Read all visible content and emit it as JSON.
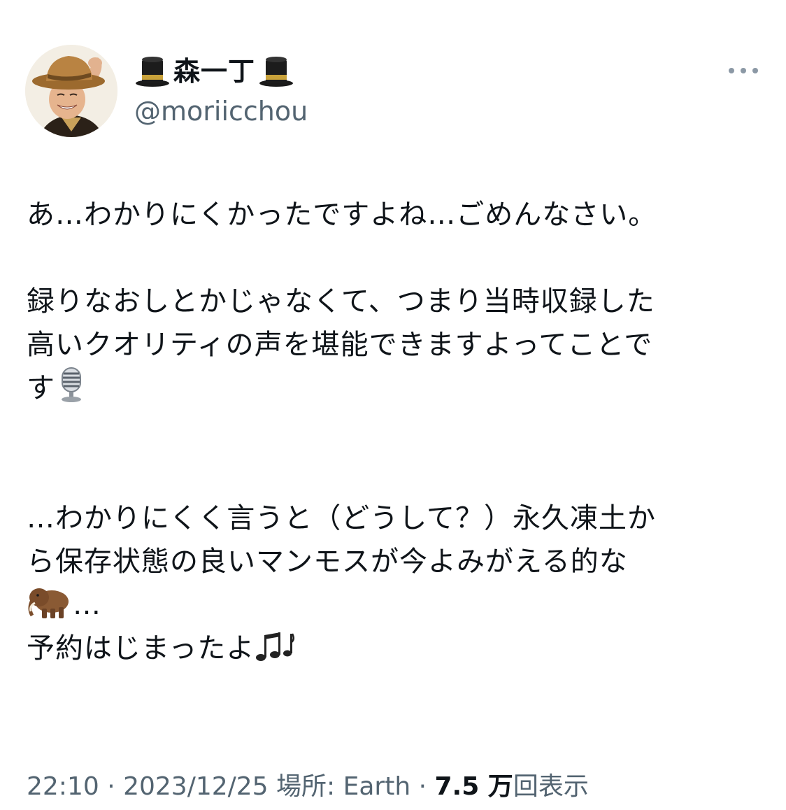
{
  "author": {
    "display_name": "森一丁",
    "handle": "@moriicchou",
    "name_emoji": "top-hat-icon"
  },
  "tweet": {
    "line_1": "あ…わかりにくかったですよね…ごめんなさい。",
    "line_2": "録りなおしとかじゃなくて、つまり当時収録した",
    "line_3": "高いクオリティの声を堪能できますよってことで",
    "line_4": "す",
    "line_4_emoji": "studio-microphone-icon",
    "line_5": "…わかりにくく言うと（どうして？）永久凍土か",
    "line_6": "ら保存状態の良いマンモスが今よみがえる的な",
    "line_7_emoji": "mammoth-icon",
    "line_7": "…",
    "line_8": "予約はじまったよ",
    "line_8_emoji": "musical-notes-icon"
  },
  "meta": {
    "time": "22:10",
    "sep_1": " · ",
    "date": "2023/12/25",
    "location_label": " 場所: Earth",
    "sep_2": " · ",
    "views_count": "7.5 万",
    "views_label": "回表示"
  },
  "colors": {
    "text_primary": "#0f1419",
    "text_secondary": "#536471",
    "background": "#ffffff"
  }
}
